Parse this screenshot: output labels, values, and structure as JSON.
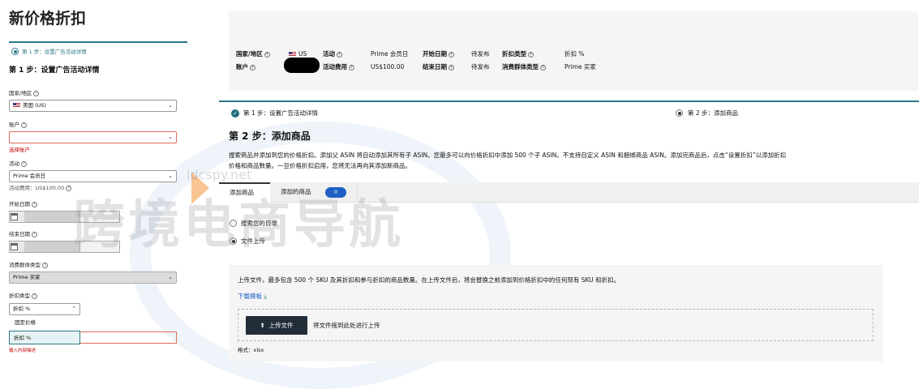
{
  "left": {
    "page_title": "新价格折扣",
    "step_nav_label": "第 1 步：设置广告活动详情",
    "step_heading": "第 1 步：设置广告活动详情",
    "fields": {
      "country_label": "国家/地区",
      "country_value": "美国 (US)",
      "account_label": "账户",
      "account_error": "选择账户",
      "event_label": "活动",
      "event_value": "Prime 会员日",
      "event_fee_note": "活动费用：US$100.00",
      "start_label": "开始日期",
      "end_label": "结束日期",
      "audience_label": "消费群体类型",
      "audience_value": "Prime 买家",
      "discount_type_label": "折扣类型",
      "discount_type_value": "折扣 %",
      "dropdown_option_fixed": "固定价格",
      "dropdown_option_percent": "折扣 %",
      "input_error": "输入内部描述"
    }
  },
  "summary": {
    "country_label": "国家/地区",
    "country_value": "US",
    "event_label": "活动",
    "event_value": "Prime 会员日",
    "start_label": "开始日期",
    "start_value": "待发布",
    "discount_type_label": "折扣类型",
    "discount_type_value": "折扣 %",
    "account_label": "账户",
    "fee_label": "活动费用",
    "fee_value": "US$100.00",
    "end_label": "结束日期",
    "end_value": "待发布",
    "audience_label": "消费群体类型",
    "audience_value": "Prime 买家"
  },
  "steps": {
    "step1_label": "第 1 步：设置广告活动详情",
    "step2_label": "第 2 步：添加商品"
  },
  "main": {
    "heading": "第 2 步：添加商品",
    "description_line1": "搜索商品并添加到您的价格折扣。添加父 ASIN 将自动添加其所有子 ASIN。您最多可以向价格折扣中添加 500 个子 ASIN。不支持自定义 ASIN 和捆绑商品 ASIN。添加完商品后，点击“设置折扣”以添加折扣",
    "description_line2": "价格和商品数量。一旦价格折扣启用，您将无法再向其添加新商品。",
    "tab_add": "添加商品",
    "tab_added": "添加的商品",
    "tab_added_count": "0",
    "option_search": "搜索您的目录",
    "option_upload": "文件上传",
    "upload_info": "上传文件，最多包含 500 个 SKU 及其折扣和参与折扣的商品数量。在上传文件后，将会替换之前添加到价格折扣中的任何现有 SKU 和折扣。",
    "download_template": "下载模板",
    "upload_button": "上传文件",
    "drop_hint": "将文件拖到此处进行上传",
    "format_label": "格式：xlsx"
  },
  "watermark": {
    "text": "跨境电商导航",
    "url": "idcspy.net"
  },
  "colors": {
    "accent_teal": "#2b7a85",
    "badge_blue": "#1f5fc4",
    "error_red": "#c40000",
    "upload_button_bg": "#222d3a"
  }
}
